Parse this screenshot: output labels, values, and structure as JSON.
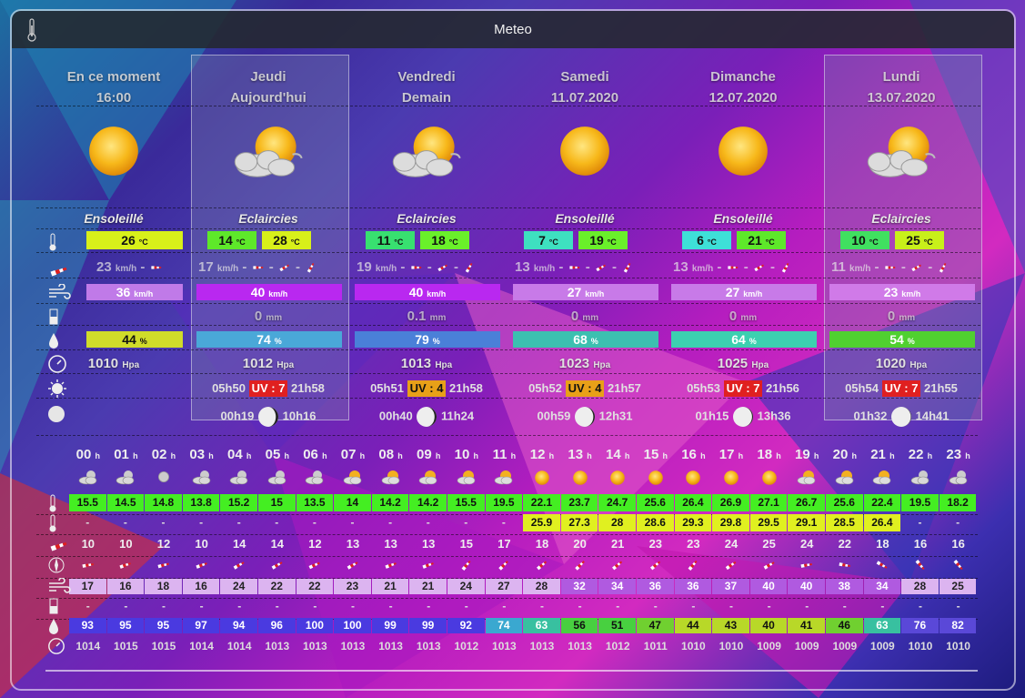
{
  "window": {
    "title": "Meteo"
  },
  "colors": {
    "titlebar": "#23282d",
    "highlight_col": "#7882aa"
  },
  "current": {
    "label": "En ce moment",
    "time": "16:00",
    "condition": "Ensoleillé",
    "temp": "26",
    "temp_unit": "°C",
    "temp_color": "#d8f01a",
    "wind": "23",
    "wind_unit": "km/h",
    "gust": "36",
    "gust_unit": "km/h",
    "gust_color": "#c07ae8",
    "humidity": "44",
    "humidity_unit": "%",
    "humidity_color": "#d0dc2a",
    "pressure": "1010",
    "pressure_unit": "Hpa",
    "icon": "sun-icon"
  },
  "days": [
    {
      "name": "Jeudi",
      "date": "Aujourd'hui",
      "condition": "Eclaircies",
      "icon": "partly-cloudy-icon",
      "tmin": "14",
      "tmax": "28",
      "tmin_color": "#5ee82a",
      "tmax_color": "#d8f01a",
      "wind": "17",
      "gust": "40",
      "gust_color": "#b928f0",
      "rain": "0",
      "rain_unit": "mm",
      "humidity": "74",
      "humidity_color": "#4aa8d8",
      "pressure": "1012",
      "sunrise": "05h50",
      "uv": "UV : 7",
      "uv_color": "#e02020",
      "sunset": "21h58",
      "moonrise": "00h19",
      "moonset": "10h16",
      "moon_phase": 0.75
    },
    {
      "name": "Vendredi",
      "date": "Demain",
      "condition": "Eclaircies",
      "icon": "partly-cloudy-icon",
      "tmin": "11",
      "tmax": "18",
      "tmin_color": "#38e070",
      "tmax_color": "#6af02a",
      "wind": "19",
      "gust": "40",
      "gust_color": "#b928f0",
      "rain": "0.1",
      "rain_unit": "mm",
      "humidity": "79",
      "humidity_color": "#4a80d8",
      "pressure": "1013",
      "sunrise": "05h51",
      "uv": "UV : 4",
      "uv_color": "#e8a018",
      "sunset": "21h58",
      "moonrise": "00h40",
      "moonset": "11h24",
      "moon_phase": 0.8
    },
    {
      "name": "Samedi",
      "date": "11.07.2020",
      "condition": "Ensoleillé",
      "icon": "sun-icon",
      "tmin": "7",
      "tmax": "19",
      "tmin_color": "#3ee0c0",
      "tmax_color": "#6af02a",
      "wind": "13",
      "gust": "27",
      "gust_color": "#c87ae8",
      "rain": "0",
      "rain_unit": "mm",
      "humidity": "68",
      "humidity_color": "#3cc0b0",
      "pressure": "1023",
      "sunrise": "05h52",
      "uv": "UV : 4",
      "uv_color": "#e8a018",
      "sunset": "21h57",
      "moonrise": "00h59",
      "moonset": "12h31",
      "moon_phase": 0.85
    },
    {
      "name": "Dimanche",
      "date": "12.07.2020",
      "condition": "Ensoleillé",
      "icon": "sun-icon",
      "tmin": "6",
      "tmax": "21",
      "tmin_color": "#3ee0d8",
      "tmax_color": "#5ee82a",
      "wind": "13",
      "gust": "27",
      "gust_color": "#c87ae8",
      "rain": "0",
      "rain_unit": "mm",
      "humidity": "64",
      "humidity_color": "#3cd0b0",
      "pressure": "1025",
      "sunrise": "05h53",
      "uv": "UV : 7",
      "uv_color": "#e02020",
      "sunset": "21h56",
      "moonrise": "01h15",
      "moonset": "13h36",
      "moon_phase": 0.9
    },
    {
      "name": "Lundi",
      "date": "13.07.2020",
      "condition": "Eclaircies",
      "icon": "partly-cloudy-icon",
      "tmin": "10",
      "tmax": "25",
      "tmin_color": "#40e060",
      "tmax_color": "#c8f01a",
      "wind": "11",
      "gust": "23",
      "gust_color": "#d07ae8",
      "rain": "0",
      "rain_unit": "mm",
      "humidity": "54",
      "humidity_color": "#50d030",
      "pressure": "1020",
      "sunrise": "05h54",
      "uv": "UV : 7",
      "uv_color": "#e02020",
      "sunset": "21h55",
      "moonrise": "01h32",
      "moonset": "14h41",
      "moon_phase": 0.95
    }
  ],
  "units": {
    "temp": "°C",
    "wind": "km/h",
    "pressure": "Hpa",
    "percent": "%",
    "hour": "h"
  },
  "hourly": {
    "hours": [
      "00",
      "01",
      "02",
      "03",
      "04",
      "05",
      "06",
      "07",
      "08",
      "09",
      "10",
      "11",
      "12",
      "13",
      "14",
      "15",
      "16",
      "17",
      "18",
      "19",
      "20",
      "21",
      "22",
      "23"
    ],
    "icons": [
      "cloud-night-icon",
      "cloud-night-icon",
      "moon-icon",
      "cloud-night-icon",
      "cloud-night-icon",
      "cloud-night-icon",
      "cloud-night-icon",
      "partly-cloudy-icon",
      "partly-cloudy-icon",
      "partly-cloudy-icon",
      "partly-cloudy-icon",
      "partly-cloudy-icon",
      "sun-icon",
      "sun-icon",
      "sun-icon",
      "sun-icon",
      "sun-icon",
      "sun-icon",
      "sun-icon",
      "partly-cloudy-icon",
      "partly-cloudy-icon",
      "partly-cloudy-icon",
      "cloud-night-icon",
      "cloud-night-icon"
    ],
    "temp": [
      "15.5",
      "14.5",
      "14.8",
      "13.8",
      "15.2",
      "15",
      "13.5",
      "14",
      "14.2",
      "14.2",
      "15.5",
      "19.5",
      "22.1",
      "23.7",
      "24.7",
      "25.6",
      "26.4",
      "26.9",
      "27.1",
      "26.7",
      "25.6",
      "22.4",
      "19.5",
      "18.2"
    ],
    "feels": [
      "-",
      "-",
      "-",
      "-",
      "-",
      "-",
      "-",
      "-",
      "-",
      "-",
      "-",
      "-",
      "25.9",
      "27.3",
      "28",
      "28.6",
      "29.3",
      "29.8",
      "29.5",
      "29.1",
      "28.5",
      "26.4",
      "-",
      "-"
    ],
    "wind": [
      "10",
      "10",
      "12",
      "10",
      "14",
      "14",
      "12",
      "13",
      "13",
      "13",
      "15",
      "17",
      "18",
      "20",
      "21",
      "23",
      "23",
      "24",
      "25",
      "24",
      "22",
      "18",
      "16",
      "16"
    ],
    "gust": [
      "17",
      "16",
      "18",
      "16",
      "24",
      "22",
      "22",
      "23",
      "21",
      "21",
      "24",
      "27",
      "28",
      "32",
      "34",
      "36",
      "36",
      "37",
      "40",
      "40",
      "38",
      "34",
      "28",
      "25"
    ],
    "rain": [
      "-",
      "-",
      "-",
      "-",
      "-",
      "-",
      "-",
      "-",
      "-",
      "-",
      "-",
      "-",
      "-",
      "-",
      "-",
      "-",
      "-",
      "-",
      "-",
      "-",
      "-",
      "-",
      "-",
      "-"
    ],
    "humidity": [
      "93",
      "95",
      "95",
      "97",
      "94",
      "96",
      "100",
      "100",
      "99",
      "99",
      "92",
      "74",
      "63",
      "56",
      "51",
      "47",
      "44",
      "43",
      "40",
      "41",
      "46",
      "63",
      "76",
      "82"
    ],
    "pressure": [
      "1014",
      "1015",
      "1015",
      "1014",
      "1014",
      "1013",
      "1013",
      "1013",
      "1013",
      "1013",
      "1012",
      "1013",
      "1013",
      "1013",
      "1012",
      "1011",
      "1010",
      "1010",
      "1009",
      "1009",
      "1009",
      "1009",
      "1010",
      "1010"
    ],
    "temp_color": "#44ee22",
    "feels_color": "#e0f020",
    "gust_color": "#dcb4f0"
  }
}
